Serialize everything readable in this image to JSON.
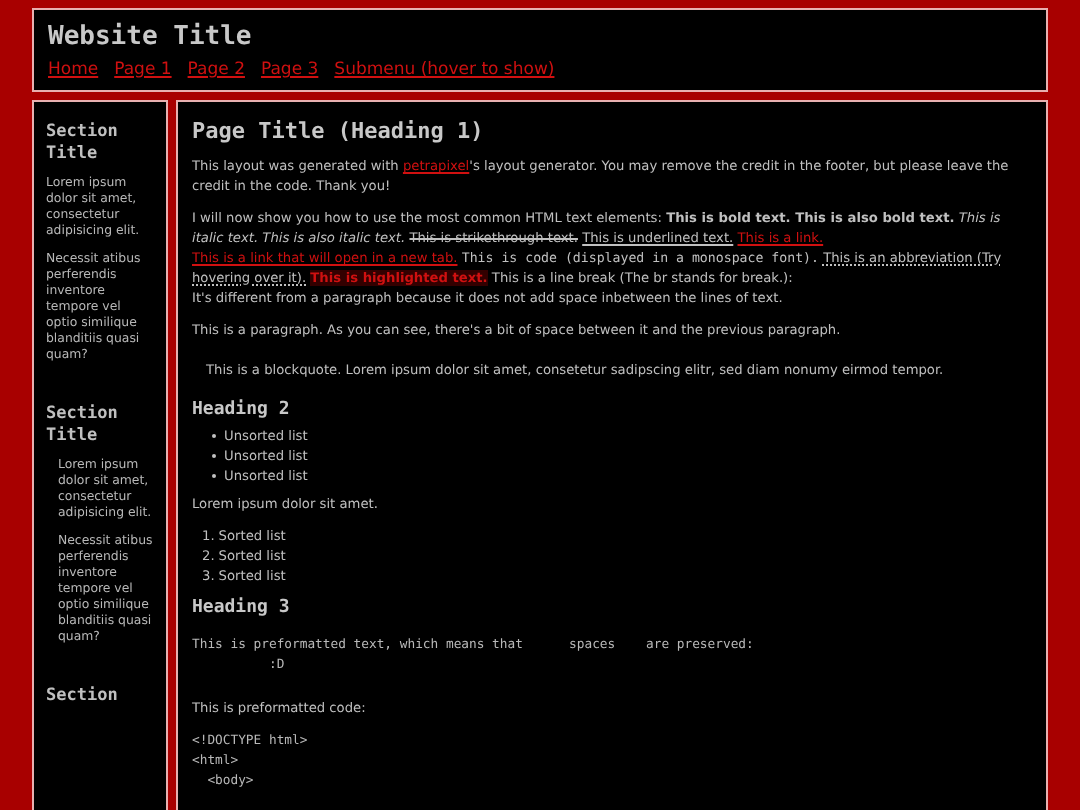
{
  "header": {
    "title": "Website Title",
    "nav": [
      "Home",
      "Page 1",
      "Page 2",
      "Page 3",
      "Submenu (hover to show)"
    ]
  },
  "sidebar": {
    "sections": [
      {
        "title": "Section Title",
        "indented": false,
        "paragraphs": [
          "Lorem ipsum dolor sit amet, consectetur adipisicing elit.",
          "Necessit atibus perferendis inventore tempore vel optio similique blanditiis quasi quam?"
        ]
      },
      {
        "title": "Section Title",
        "indented": true,
        "paragraphs": [
          "Lorem ipsum dolor sit amet, consectetur adipisicing elit.",
          "Necessit atibus perferendis inventore tempore vel optio similique blanditiis quasi quam?"
        ]
      },
      {
        "title": "Section"
      }
    ]
  },
  "main": {
    "title": "Page Title (Heading 1)",
    "credit": [
      {
        "kind": "text",
        "text": "This layout was generated with "
      },
      {
        "kind": "link",
        "text": "petrapixel"
      },
      {
        "kind": "text",
        "text": "'s layout generator. You may remove the credit in the footer, but please leave the credit in the code. Thank you!"
      }
    ],
    "elements": [
      {
        "kind": "text",
        "text": "I will now show you how to use the most common HTML text elements:"
      },
      {
        "kind": "bold",
        "text": "This is bold text. This is also bold text."
      },
      {
        "kind": "italic",
        "text": "This is italic text. This is also italic text."
      },
      {
        "kind": "strike",
        "text": "This is strikethrough text."
      },
      {
        "kind": "underline",
        "text": "This is underlined text."
      },
      {
        "kind": "link",
        "text": "This is a link."
      },
      {
        "kind": "link",
        "text": "This is a link that will open in a new tab."
      },
      {
        "kind": "code",
        "text": "This is code (displayed in a monospace font)."
      },
      {
        "kind": "abbr",
        "text": "This is an abbreviation (Try hovering over it)."
      },
      {
        "kind": "highlight",
        "text": "This is highlighted text."
      },
      {
        "kind": "text",
        "text": "This is a line break (The br stands for break.):"
      },
      {
        "kind": "break"
      },
      {
        "kind": "text",
        "text": "It's different from a paragraph because it does not add space inbetween the lines of text."
      }
    ],
    "paragraph": "This is a paragraph. As you can see, there's a bit of space between it and the previous paragraph.",
    "blockquote": "This is a blockquote. Lorem ipsum dolor sit amet, consetetur sadipscing elitr, sed diam nonumy eirmod tempor.",
    "heading2": "Heading 2",
    "unordered_list": [
      "Unsorted list",
      "Unsorted list",
      "Unsorted list"
    ],
    "lorem": "Lorem ipsum dolor sit amet.",
    "ordered_list": [
      {
        "number": "1.",
        "text": "Sorted list"
      },
      {
        "number": "2.",
        "text": "Sorted list"
      },
      {
        "number": "3.",
        "text": "Sorted list"
      }
    ],
    "heading3": "Heading 3",
    "preformatted": "This is preformatted text, which means that      spaces    are preserved:\n          :D",
    "code_intro": "This is preformatted code:",
    "code_lines": [
      "<!DOCTYPE html>",
      "<html>",
      "  <body>"
    ]
  }
}
